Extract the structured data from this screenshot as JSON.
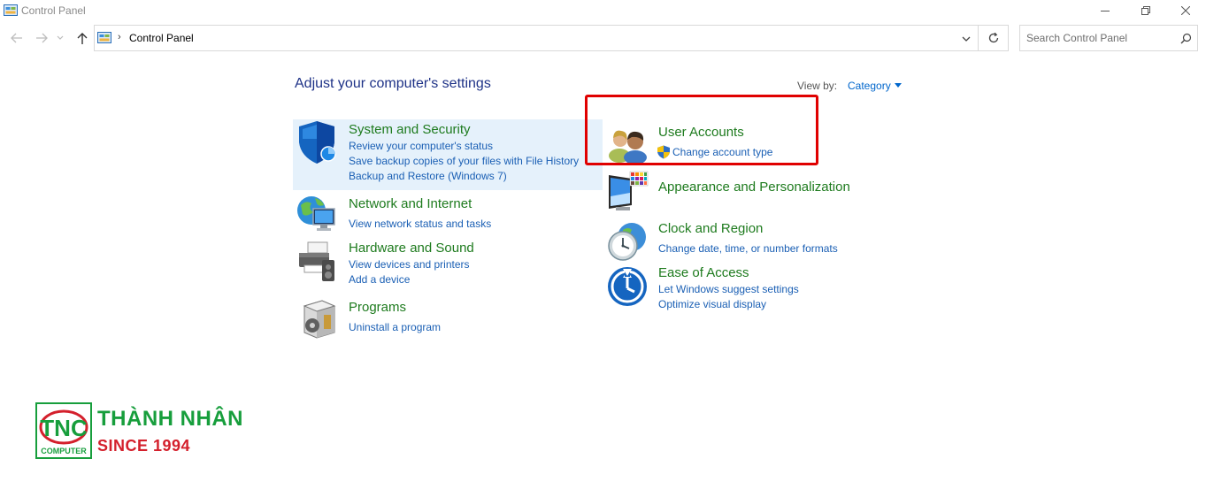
{
  "window": {
    "title": "Control Panel"
  },
  "address": {
    "crumb": "Control Panel",
    "separator": "›"
  },
  "search": {
    "placeholder": "Search Control Panel"
  },
  "main": {
    "heading": "Adjust your computer's settings",
    "view_by_label": "View by:",
    "view_by_value": "Category"
  },
  "categories": {
    "system_security": {
      "title": "System and Security",
      "links": [
        "Review your computer's status",
        "Save backup copies of your files with File History",
        "Backup and Restore (Windows 7)"
      ]
    },
    "network": {
      "title": "Network and Internet",
      "links": [
        "View network status and tasks"
      ]
    },
    "hardware": {
      "title": "Hardware and Sound",
      "links": [
        "View devices and printers",
        "Add a device"
      ]
    },
    "programs": {
      "title": "Programs",
      "links": [
        "Uninstall a program"
      ]
    },
    "user_accounts": {
      "title": "User Accounts",
      "links": [
        "Change account type"
      ]
    },
    "appearance": {
      "title": "Appearance and Personalization",
      "links": []
    },
    "clock": {
      "title": "Clock and Region",
      "links": [
        "Change date, time, or number formats"
      ]
    },
    "ease": {
      "title": "Ease of Access",
      "links": [
        "Let Windows suggest settings",
        "Optimize visual display"
      ]
    }
  },
  "logo": {
    "brand": "THÀNH NHÂN",
    "since": "SINCE 1994",
    "mark_letters": "TNC",
    "mark_caption": "COMPUTER"
  },
  "colors": {
    "category_title": "#1e7b1e",
    "link": "#1a5fb4",
    "heading": "#1e3287",
    "highlight": "#e5f1fb",
    "annotation": "#e00000",
    "brand_green": "#179e3c",
    "brand_red": "#d4202c"
  },
  "icons": {
    "app": "control-panel-icon",
    "system_security": "shield-icon",
    "network": "globe-monitor-icon",
    "hardware": "printer-speaker-icon",
    "programs": "program-box-icon",
    "user_accounts": "users-icon",
    "appearance": "monitor-palette-icon",
    "clock": "clock-globe-icon",
    "ease": "ease-of-access-icon",
    "uac": "uac-shield-icon"
  }
}
